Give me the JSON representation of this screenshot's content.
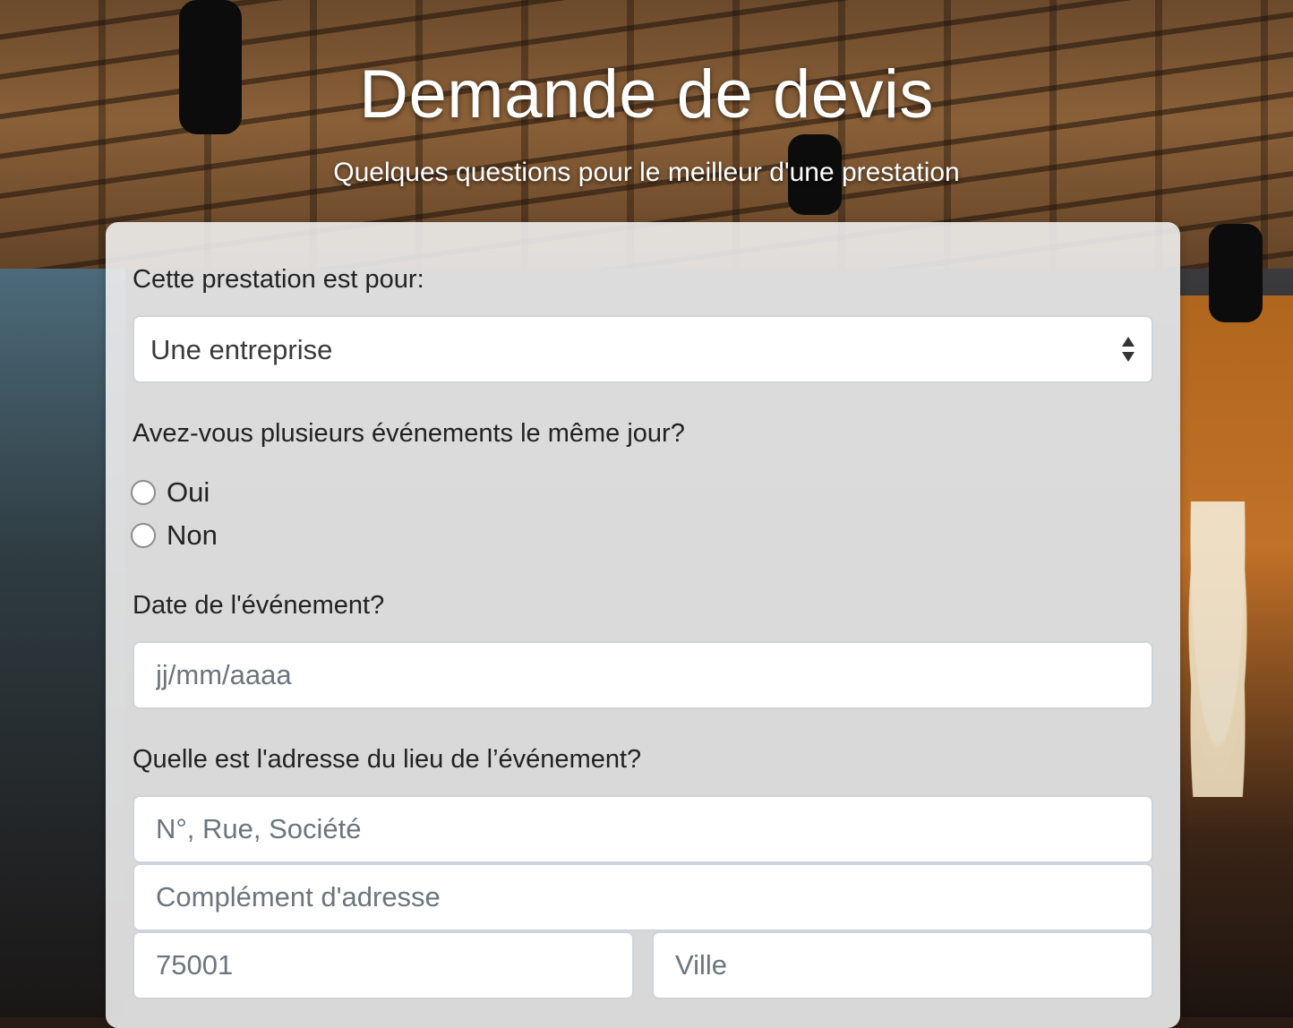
{
  "header": {
    "title": "Demande de devis",
    "subtitle": "Quelques questions pour le meilleur d'une prestation"
  },
  "form": {
    "for_question": "Cette prestation est pour:",
    "for_selected": "Une entreprise",
    "multi_event_question": "Avez-vous plusieurs événements le même jour?",
    "multi_event_options": [
      "Oui",
      "Non"
    ],
    "date_question": "Date de l'événement?",
    "date_placeholder": "jj/mm/aaaa",
    "address_question": "Quelle est l'adresse du lieu de l’événement?",
    "street_placeholder": "N°, Rue, Société",
    "complement_placeholder": "Complément d'adresse",
    "postal_placeholder": "75001",
    "city_placeholder": "Ville"
  },
  "colors": {
    "card_background": "#f2f2f2",
    "input_border": "#ced4da",
    "placeholder_text": "#6c757d",
    "heading_text": "#ffffff"
  }
}
